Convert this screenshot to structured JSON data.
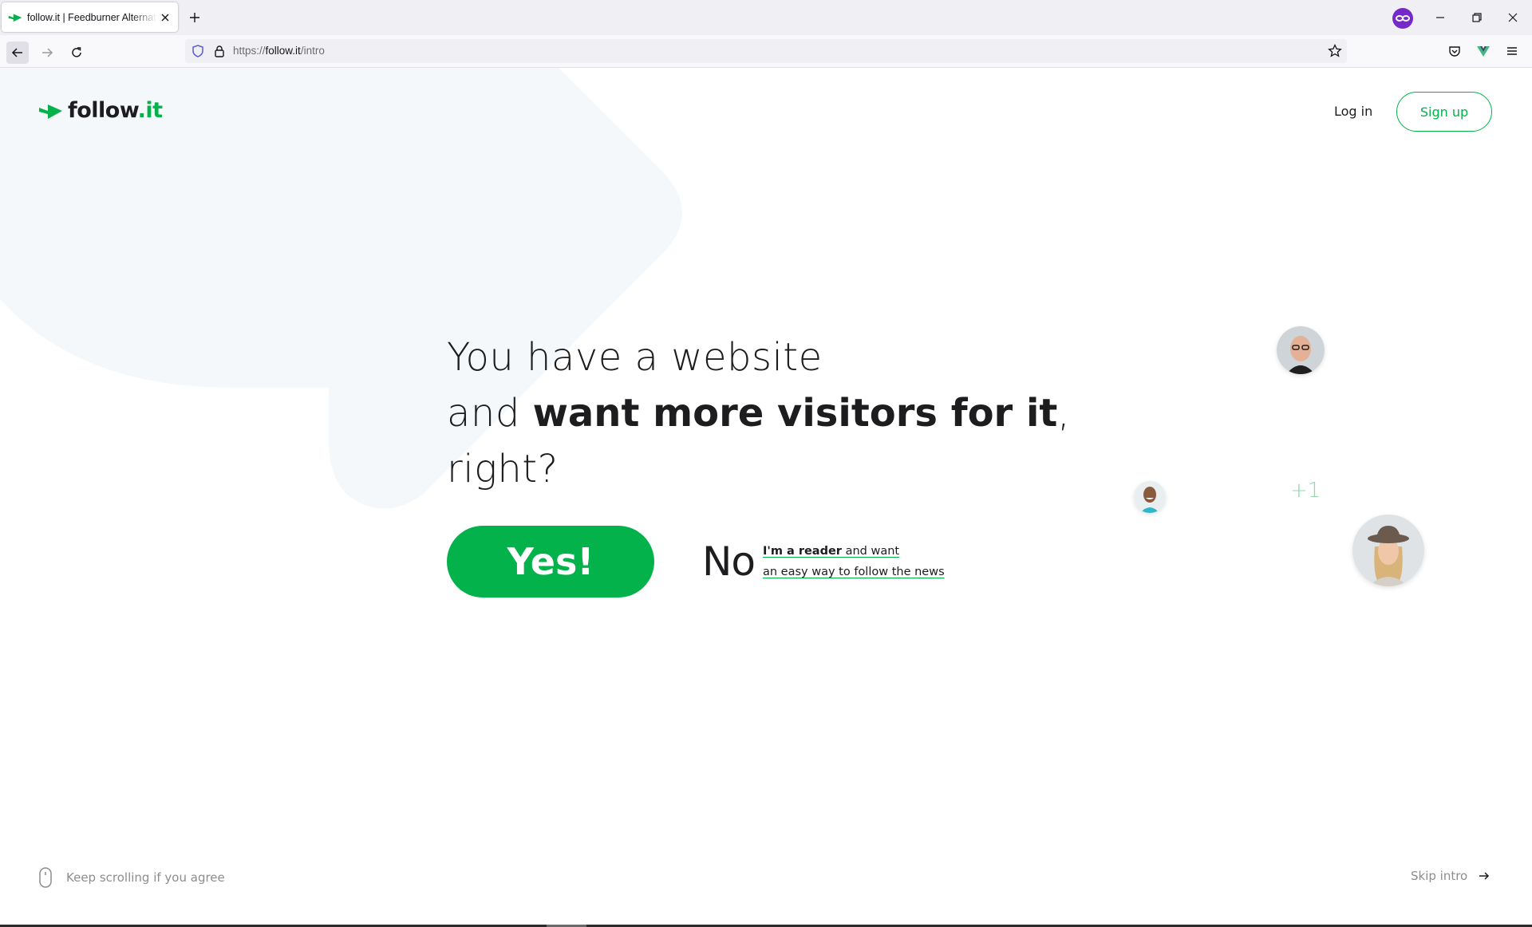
{
  "browser": {
    "tab_title": "follow.it | Feedburner Alternative",
    "url_prefix": "https://",
    "url_host": "follow.it",
    "url_path": "/intro"
  },
  "header": {
    "logo_word": "follow",
    "logo_tld": ".it",
    "login_label": "Log in",
    "signup_label": "Sign up"
  },
  "hero": {
    "line1": "You have a website",
    "line2_pre": "and ",
    "line2_bold": "want more visitors for it",
    "line2_post": ",",
    "line3": "right?",
    "yes_label": "Yes!",
    "no_label": "No",
    "no_sub_bold": "I'm a reader",
    "no_sub_rest": " and want",
    "no_sub_line2": "an easy way to follow the news",
    "plus_count": "+1"
  },
  "footer": {
    "scroll_hint": "Keep scrolling if you agree",
    "skip_label": "Skip intro"
  },
  "colors": {
    "brand_green": "#04b24b",
    "text_dark": "#1d1d1f",
    "muted": "#8d8d8d",
    "bg_shape": "#f5f8fa"
  }
}
